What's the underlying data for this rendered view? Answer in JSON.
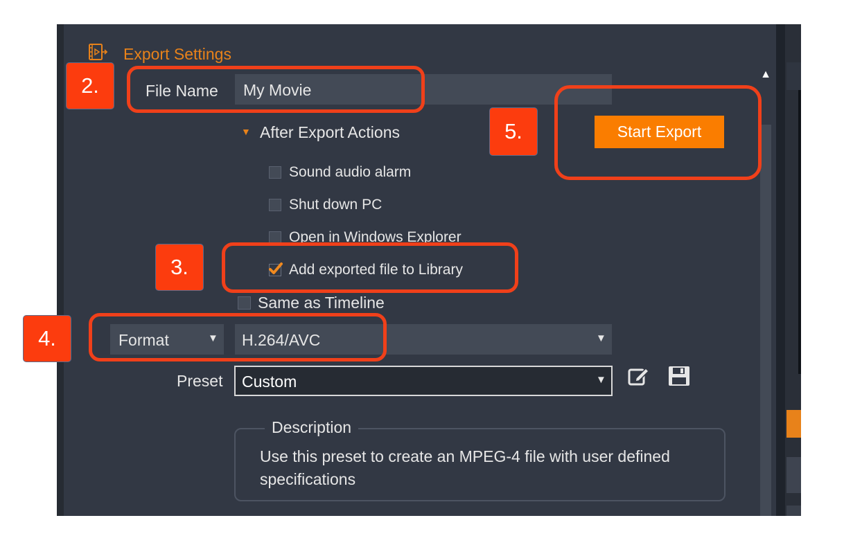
{
  "header": {
    "title": "Export Settings"
  },
  "file_name": {
    "label": "File Name",
    "value": "My Movie"
  },
  "after_export": {
    "label": "After Export Actions",
    "options": [
      {
        "label": "Sound audio alarm",
        "checked": false
      },
      {
        "label": "Shut down PC",
        "checked": false
      },
      {
        "label": "Open in Windows Explorer",
        "checked": false
      },
      {
        "label": "Add exported file to Library",
        "checked": true
      }
    ]
  },
  "same_as_timeline": {
    "label": "Same as Timeline",
    "checked": false
  },
  "format": {
    "label": "Format",
    "value": "H.264/AVC"
  },
  "preset": {
    "label": "Preset",
    "value": "Custom"
  },
  "description": {
    "legend": "Description",
    "text": "Use this preset to create an MPEG-4 file with user defined specifications"
  },
  "actions": {
    "start_export": "Start Export"
  },
  "annotations": [
    "2.",
    "3.",
    "4.",
    "5."
  ],
  "colors": {
    "accent": "#e8821a",
    "button": "#fa7d00",
    "panel": "#323844",
    "highlight": "#f0401a"
  }
}
